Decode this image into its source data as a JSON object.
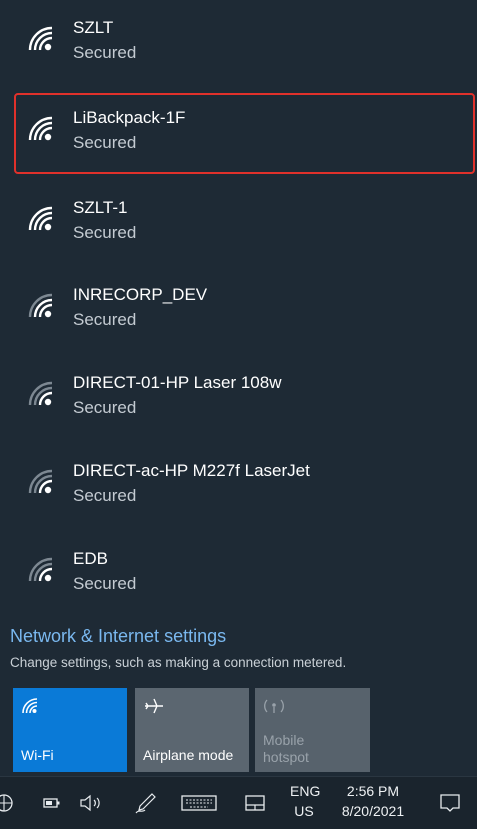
{
  "networks": [
    {
      "name": "SZLT",
      "status": "Secured",
      "selected": false
    },
    {
      "name": "LiBackpack-1F",
      "status": "Secured",
      "selected": true
    },
    {
      "name": "SZLT-1",
      "status": "Secured",
      "selected": false
    },
    {
      "name": "INRECORP_DEV",
      "status": "Secured",
      "selected": false
    },
    {
      "name": "DIRECT-01-HP Laser 108w",
      "status": "Secured",
      "selected": false
    },
    {
      "name": "DIRECT-ac-HP M227f LaserJet",
      "status": "Secured",
      "selected": false
    },
    {
      "name": "EDB",
      "status": "Secured",
      "selected": false
    }
  ],
  "settings": {
    "link": "Network & Internet settings",
    "description": "Change settings, such as making a connection metered."
  },
  "tiles": {
    "wifi": {
      "label": "Wi-Fi",
      "icon": "wifi-icon",
      "active": true
    },
    "airplane": {
      "label": "Airplane mode",
      "icon": "airplane-icon",
      "active": false
    },
    "hotspot": {
      "label_line1": "Mobile",
      "label_line2": "hotspot",
      "icon": "hotspot-icon",
      "active": false
    }
  },
  "taskbar": {
    "language_line1": "ENG",
    "language_line2": "US",
    "time": "2:56 PM",
    "date": "8/20/2021"
  },
  "colors": {
    "selection_border": "#e0312b",
    "accent": "#0a7ad7",
    "link": "#7ab8ef"
  }
}
